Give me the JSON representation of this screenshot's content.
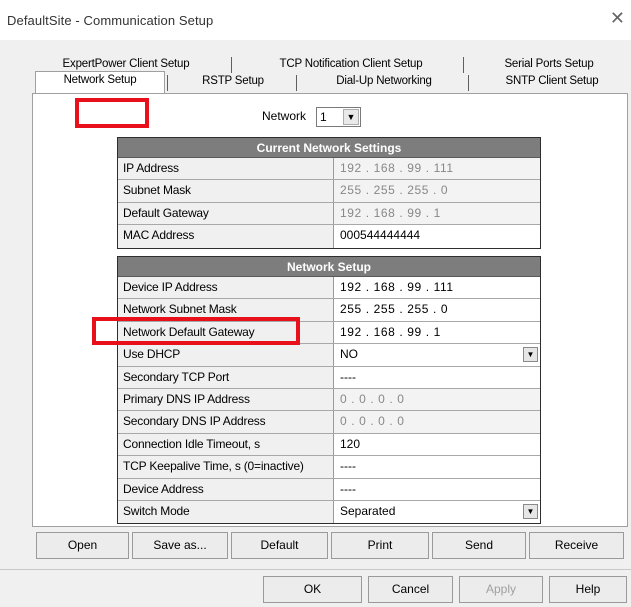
{
  "window": {
    "title": "DefaultSite - Communication Setup",
    "close_glyph": "✕"
  },
  "tabs": {
    "row1": [
      "ExpertPower Client Setup",
      "TCP Notification Client Setup",
      "Serial Ports Setup"
    ],
    "row2": [
      "Network Setup",
      "RSTP Setup",
      "Dial-Up Networking",
      "SNTP Client Setup"
    ],
    "active": "Network Setup"
  },
  "network_select": {
    "label": "Network",
    "value": "1"
  },
  "current_settings": {
    "header": "Current Network Settings",
    "rows": [
      {
        "label": "IP Address",
        "value": "192 . 168 . 99 . 111"
      },
      {
        "label": "Subnet Mask",
        "value": "255 . 255 . 255 . 0"
      },
      {
        "label": "Default Gateway",
        "value": "192 . 168 . 99 . 1"
      },
      {
        "label": "MAC Address",
        "value": "000544444444"
      }
    ]
  },
  "network_setup": {
    "header": "Network Setup",
    "rows": [
      {
        "label": "Device IP Address",
        "value": "192 . 168 . 99 . 111"
      },
      {
        "label": "Network Subnet Mask",
        "value": "255 . 255 . 255 . 0"
      },
      {
        "label": "Network Default Gateway",
        "value": "192 . 168 . 99 . 1"
      },
      {
        "label": "Use DHCP",
        "value": "NO"
      },
      {
        "label": "Secondary TCP Port",
        "value": "----"
      },
      {
        "label": "Primary DNS IP Address",
        "value": "0 . 0 . 0 . 0"
      },
      {
        "label": "Secondary DNS IP Address",
        "value": "0 . 0 . 0 . 0"
      },
      {
        "label": "Connection Idle Timeout, s",
        "value": "120"
      },
      {
        "label": "TCP Keepalive Time, s (0=inactive)",
        "value": "----"
      },
      {
        "label": "Device Address",
        "value": "----"
      },
      {
        "label": "Switch Mode",
        "value": "Separated"
      }
    ]
  },
  "panel_buttons": [
    "Open",
    "Save as...",
    "Default",
    "Print",
    "Send",
    "Receive"
  ],
  "dialog_buttons": [
    "OK",
    "Cancel",
    "Apply",
    "Help"
  ],
  "icons": {
    "dropdown": "chevron-down-icon",
    "close": "close-icon"
  },
  "colors": {
    "highlight": "#e8101a",
    "grid_header": "#7d7d7d"
  }
}
